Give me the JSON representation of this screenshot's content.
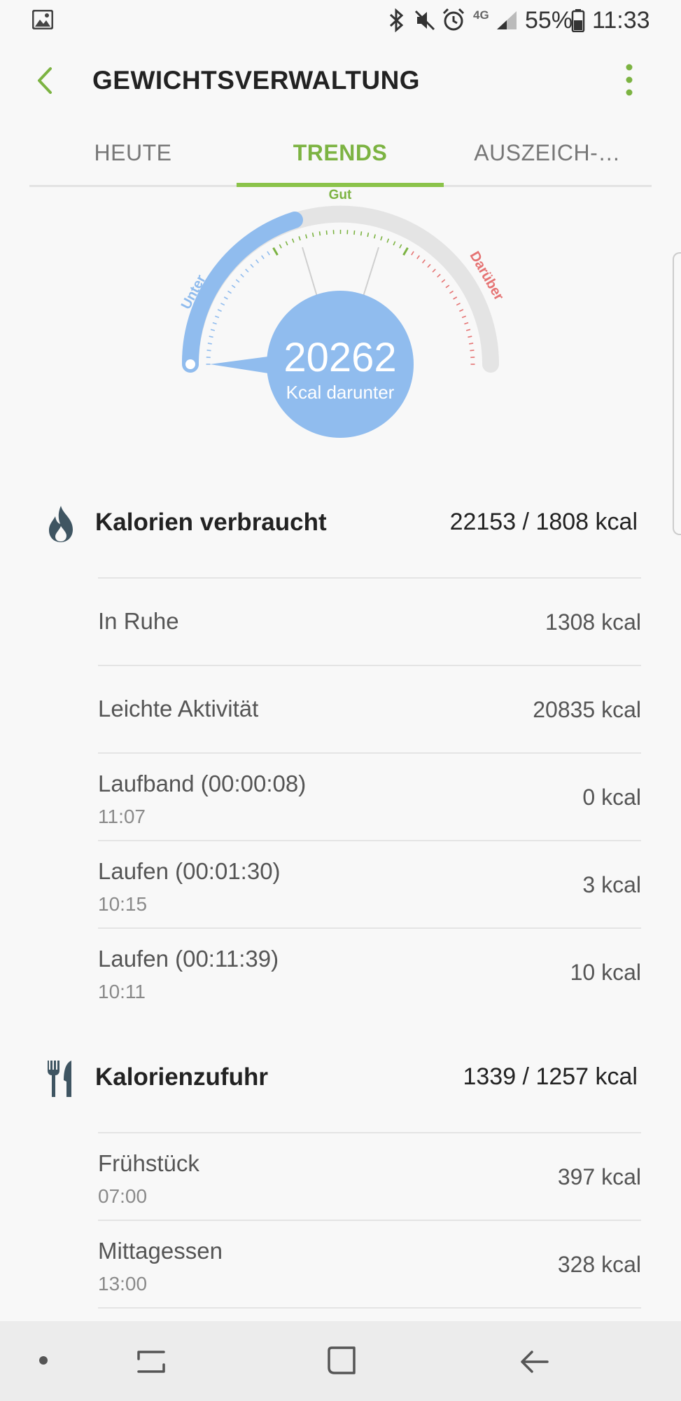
{
  "status_bar": {
    "battery_percent": "55%",
    "time": "11:33",
    "network": "4G",
    "icons": [
      "gallery-notification-icon",
      "bluetooth-icon",
      "mute-icon",
      "alarm-icon",
      "signal-icon",
      "battery-icon"
    ]
  },
  "app_bar": {
    "title": "GEWICHTSVERWALTUNG",
    "back_icon": "chevron-left-icon",
    "menu_icon": "more-vert-icon"
  },
  "tabs": [
    {
      "label": "HEUTE",
      "active": false
    },
    {
      "label": "TRENDS",
      "active": true
    },
    {
      "label": "AUSZEICH-…",
      "active": false
    }
  ],
  "gauge": {
    "label_under": "Unter",
    "label_good": "Gut",
    "label_over": "Darüber",
    "value": "20262",
    "unit_text": "Kcal darunter",
    "colors": {
      "under": "#90bcee",
      "good": "#7cb342",
      "over": "#e57373",
      "track": "#e4e4e4",
      "bubble": "#90bcee"
    }
  },
  "burned": {
    "label": "Kalorien verbraucht",
    "value": "22153 / 1808 kcal",
    "icon": "flame-icon",
    "items": [
      {
        "name": "In Ruhe",
        "time": "",
        "kcal": "1308 kcal"
      },
      {
        "name": "Leichte Aktivität",
        "time": "",
        "kcal": "20835 kcal"
      },
      {
        "name": "Laufband (00:00:08)",
        "time": "11:07",
        "kcal": "0 kcal"
      },
      {
        "name": "Laufen (00:01:30)",
        "time": "10:15",
        "kcal": "3 kcal"
      },
      {
        "name": "Laufen (00:11:39)",
        "time": "10:11",
        "kcal": "10 kcal"
      }
    ]
  },
  "intake": {
    "label": "Kalorienzufuhr",
    "value": "1339 / 1257 kcal",
    "icon": "fork-knife-icon",
    "items": [
      {
        "name": "Frühstück",
        "time": "07:00",
        "kcal": "397 kcal"
      },
      {
        "name": "Mittagessen",
        "time": "13:00",
        "kcal": "328 kcal"
      }
    ]
  },
  "nav_bar": {
    "icons": [
      "dot-icon",
      "recents-icon",
      "home-icon",
      "back-icon"
    ]
  }
}
